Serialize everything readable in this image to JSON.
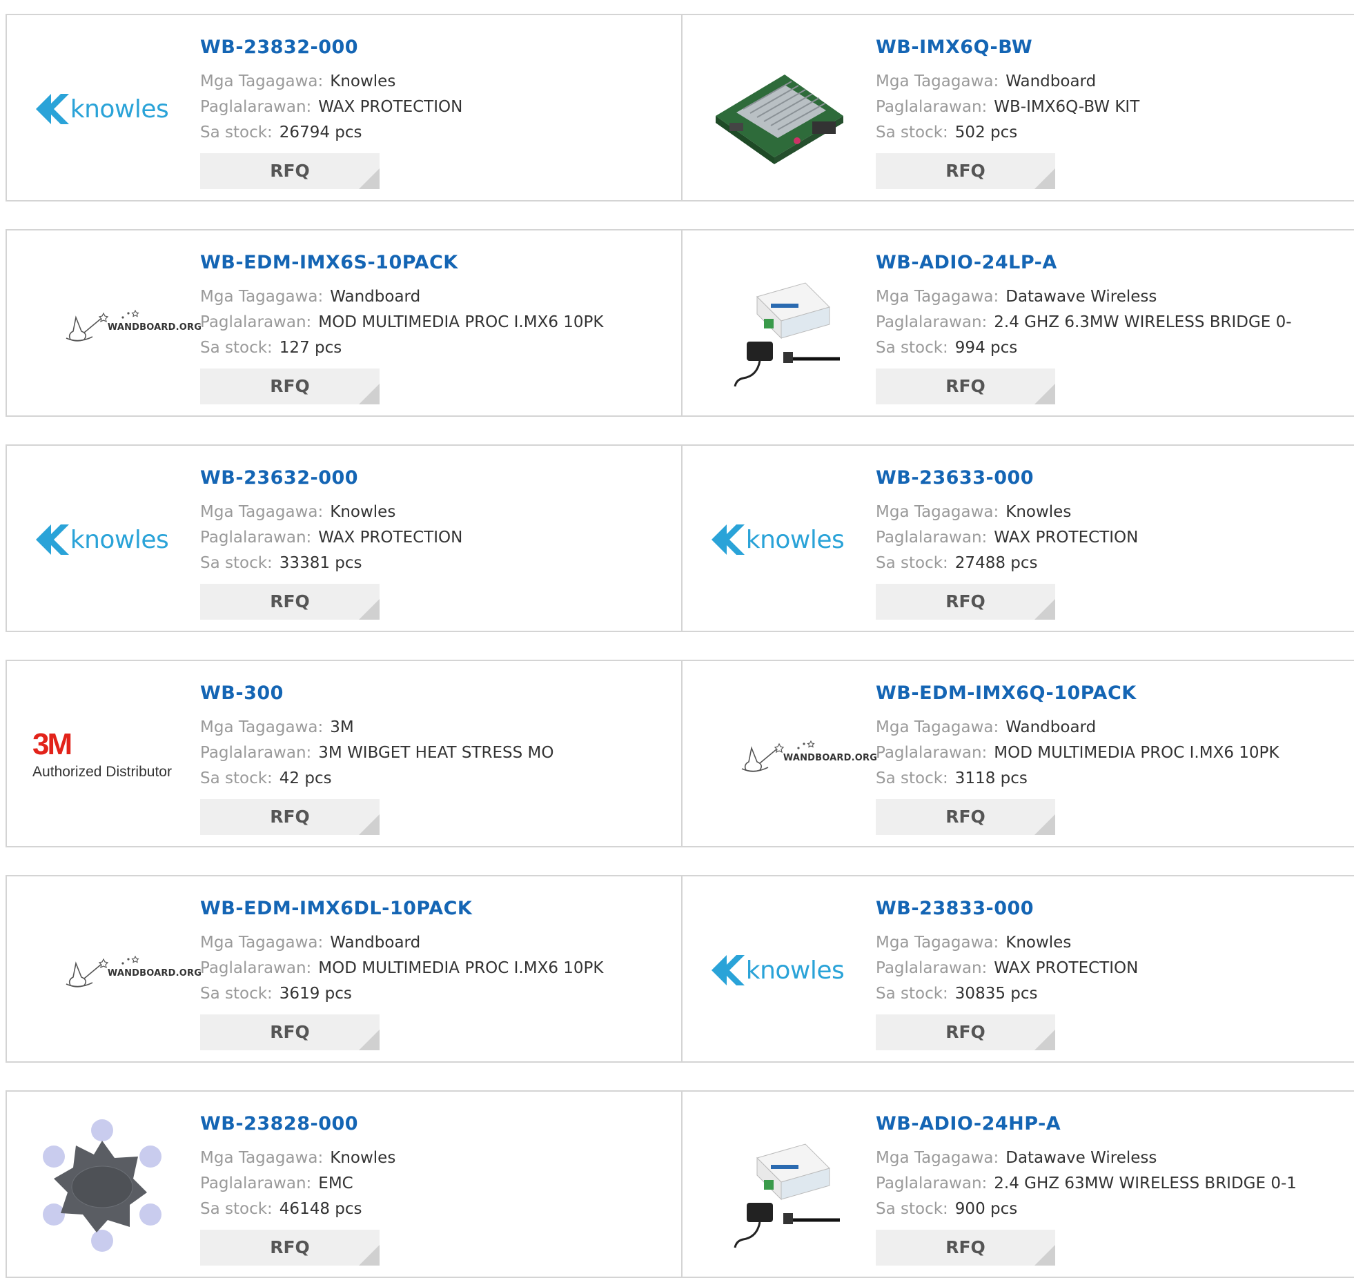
{
  "labels": {
    "manufacturer": "Mga Tagagawa:",
    "description": "Paglalarawan:",
    "stock": "Sa stock:",
    "rfq": "RFQ"
  },
  "products": [
    {
      "part": "WB-23832-000",
      "manufacturer": "Knowles",
      "description": "WAX PROTECTION",
      "stock": "26794 pcs",
      "logo": "knowles-logo"
    },
    {
      "part": "WB-IMX6Q-BW",
      "manufacturer": "Wandboard",
      "description": "WB-IMX6Q-BW KIT",
      "stock": "502 pcs",
      "logo": "board-photo"
    },
    {
      "part": "WB-EDM-IMX6S-10PACK",
      "manufacturer": "Wandboard",
      "description": "MOD MULTIMEDIA PROC I.MX6 10PK",
      "stock": "127 pcs",
      "logo": "wandboard-logo"
    },
    {
      "part": "WB-ADIO-24LP-A",
      "manufacturer": "Datawave Wireless",
      "description": "2.4 GHZ 6.3MW WIRELESS BRIDGE 0-",
      "stock": "994 pcs",
      "logo": "bridge-photo"
    },
    {
      "part": "WB-23632-000",
      "manufacturer": "Knowles",
      "description": "WAX PROTECTION",
      "stock": "33381 pcs",
      "logo": "knowles-logo"
    },
    {
      "part": "WB-23633-000",
      "manufacturer": "Knowles",
      "description": "WAX PROTECTION",
      "stock": "27488 pcs",
      "logo": "knowles-logo"
    },
    {
      "part": "WB-300",
      "manufacturer": "3M",
      "description": "3M WIBGET HEAT STRESS MO",
      "stock": "42 pcs",
      "logo": "3m-logo"
    },
    {
      "part": "WB-EDM-IMX6Q-10PACK",
      "manufacturer": "Wandboard",
      "description": "MOD MULTIMEDIA PROC I.MX6 10PK",
      "stock": "3118 pcs",
      "logo": "wandboard-logo"
    },
    {
      "part": "WB-EDM-IMX6DL-10PACK",
      "manufacturer": "Wandboard",
      "description": "MOD MULTIMEDIA PROC I.MX6 10PK",
      "stock": "3619 pcs",
      "logo": "wandboard-logo"
    },
    {
      "part": "WB-23833-000",
      "manufacturer": "Knowles",
      "description": "WAX PROTECTION",
      "stock": "30835 pcs",
      "logo": "knowles-logo"
    },
    {
      "part": "WB-23828-000",
      "manufacturer": "Knowles",
      "description": "EMC",
      "stock": "46148 pcs",
      "logo": "wax-guard-photo"
    },
    {
      "part": "WB-ADIO-24HP-A",
      "manufacturer": "Datawave Wireless",
      "description": "2.4 GHZ 63MW WIRELESS BRIDGE 0-1",
      "stock": "900 pcs",
      "logo": "bridge-photo"
    }
  ],
  "logos": {
    "knowles": "knowles",
    "threem_mark": "3M",
    "threem_sub": "Authorized Distributor",
    "wandboard": "WANDBOARD.ORG"
  },
  "colors": {
    "part_link": "#1465b4",
    "label": "#9a9a9a",
    "value": "#333333",
    "rfq_bg": "#efefef",
    "border": "#d4d4d4",
    "knowles_brand": "#2aa3d8",
    "threem_brand": "#e2231a"
  }
}
